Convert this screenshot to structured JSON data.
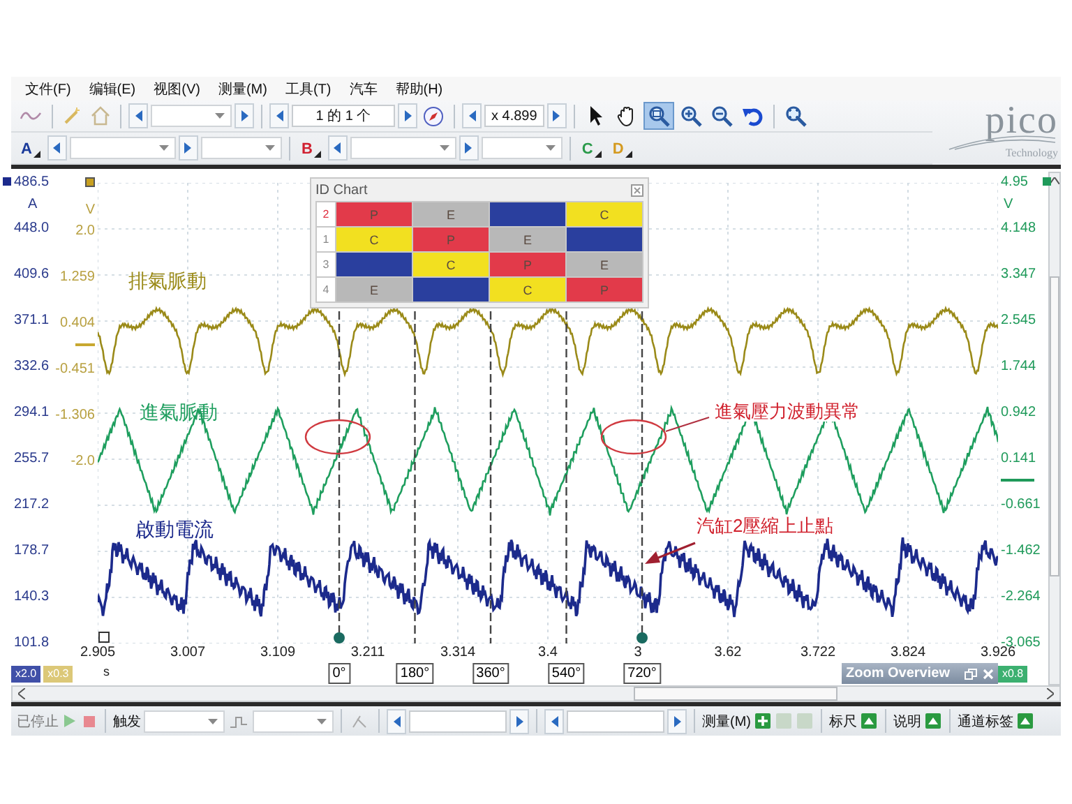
{
  "menu": [
    "文件(F)",
    "编辑(E)",
    "视图(V)",
    "测量(M)",
    "工具(T)",
    "汽车",
    "帮助(H)"
  ],
  "toolbar": {
    "page_counter": "1 的 1 个",
    "zoom_factor": "x 4.899",
    "tools": [
      {
        "kind": "pointer",
        "selected": false
      },
      {
        "kind": "hand",
        "selected": false
      },
      {
        "kind": "zoom-box",
        "selected": true
      },
      {
        "kind": "zoom-in",
        "selected": false
      },
      {
        "kind": "zoom-out",
        "selected": false
      },
      {
        "kind": "undo",
        "selected": false
      },
      {
        "kind": "zoom-fit",
        "selected": false
      }
    ]
  },
  "logo": {
    "wordmark": "pico",
    "tagline": "Technology"
  },
  "channels": [
    {
      "label": "A",
      "color": "#1a3a9a"
    },
    {
      "label": "B",
      "color": "#d02030"
    },
    {
      "label": "C",
      "color": "#2a9a4a"
    },
    {
      "label": "D",
      "color": "#d49a20"
    }
  ],
  "plot": {
    "axis_a": {
      "unit": "A",
      "ticks": [
        "486.5",
        "448.0",
        "409.6",
        "371.1",
        "332.6",
        "294.1",
        "255.7",
        "217.2",
        "178.7",
        "140.3",
        "101.8"
      ]
    },
    "axis_v_left": {
      "unit": "V",
      "ticks": [
        "2.0",
        "1.259",
        "0.404",
        "-0.451",
        "-1.306",
        "-2.0"
      ]
    },
    "axis_v_right": {
      "unit": "V",
      "ticks": [
        "4.95",
        "4.148",
        "3.347",
        "2.545",
        "1.744",
        "0.942",
        "0.141",
        "-0.661",
        "-1.462",
        "-2.264",
        "-3.065"
      ]
    },
    "time_ticks": [
      "2.905",
      "3.007",
      "3.109",
      "3.211",
      "3.314",
      "3.4",
      "3",
      "3.62",
      "3.722",
      "3.824",
      "3.926"
    ],
    "time_unit": "s",
    "traces": [
      {
        "kind": "exhaust",
        "label": "排氣脈動",
        "color": "#9a8a18"
      },
      {
        "kind": "intake",
        "label": "進氣脈動",
        "color": "#1e9e5e"
      },
      {
        "kind": "current",
        "label": "啟動電流",
        "color": "#1c2a8c"
      }
    ],
    "angle_markers": [
      {
        "label": "0°",
        "pinned": true
      },
      {
        "label": "180°",
        "pinned": false
      },
      {
        "label": "360°",
        "pinned": false
      },
      {
        "label": "540°",
        "pinned": false
      },
      {
        "label": "720°",
        "pinned": true
      }
    ],
    "notes": [
      {
        "kind": "callout",
        "text": "進氣壓力波動異常"
      },
      {
        "kind": "arrow",
        "text": "汽缸2壓縮上止點"
      }
    ],
    "scales": [
      {
        "label": "x2.0",
        "color": "#4050a8"
      },
      {
        "label": "x0.3",
        "color": "#dcc878"
      },
      {
        "label": "x0.8",
        "color": "#3cb070"
      }
    ]
  },
  "id_chart": {
    "title": "ID Chart",
    "rows": [
      {
        "label": "2",
        "selected": true,
        "cells": [
          {
            "text": "P",
            "color": "#e23a4a"
          },
          {
            "text": "E",
            "color": "#b8b8b8"
          },
          {
            "color": "#2a3f9e"
          },
          {
            "text": "C",
            "color": "#f2e020"
          }
        ]
      },
      {
        "label": "1",
        "selected": false,
        "cells": [
          {
            "text": "C",
            "color": "#f2e020"
          },
          {
            "text": "P",
            "color": "#e23a4a"
          },
          {
            "text": "E",
            "color": "#b8b8b8"
          },
          {
            "color": "#2a3f9e"
          }
        ]
      },
      {
        "label": "3",
        "selected": false,
        "cells": [
          {
            "color": "#2a3f9e"
          },
          {
            "text": "C",
            "color": "#f2e020"
          },
          {
            "text": "P",
            "color": "#e23a4a"
          },
          {
            "text": "E",
            "color": "#b8b8b8"
          }
        ]
      },
      {
        "label": "4",
        "selected": false,
        "cells": [
          {
            "text": "E",
            "color": "#b8b8b8"
          },
          {
            "color": "#2a3f9e"
          },
          {
            "text": "C",
            "color": "#f2e020"
          },
          {
            "text": "P",
            "color": "#e23a4a"
          }
        ]
      }
    ]
  },
  "zoom_overview": {
    "title": "Zoom Overview"
  },
  "status_bar": {
    "state": "已停止",
    "trigger": "触发",
    "measure": "测量(M)",
    "toggles": [
      {
        "label": "标尺"
      },
      {
        "label": "说明"
      },
      {
        "label": "通道标签"
      }
    ]
  }
}
